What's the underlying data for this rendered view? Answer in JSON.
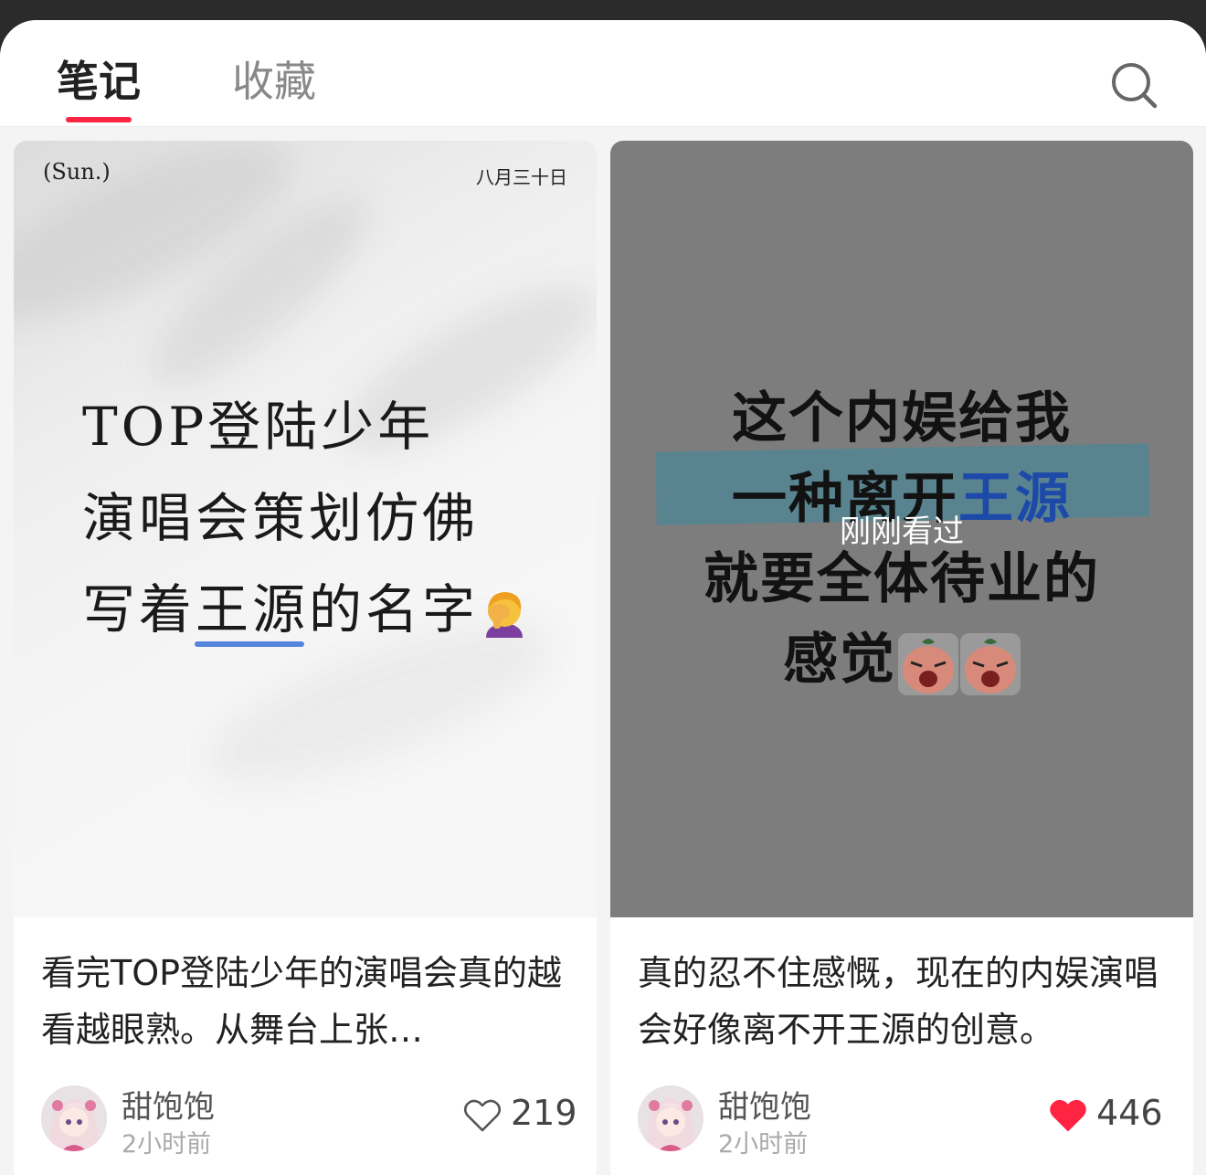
{
  "tabs": {
    "notes": "笔记",
    "favorites": "收藏"
  },
  "colors": {
    "accent": "#ff2442",
    "liked_heart": "#ff2442"
  },
  "icons": {
    "search": "search-icon",
    "like_outline": "heart-outline-icon",
    "like_filled": "heart-filled-icon"
  },
  "cards": [
    {
      "cover": {
        "weekday": "(Sun.)",
        "date": "八月三十日",
        "lines": [
          "TOP登陆少年",
          "演唱会策划仿佛",
          "写着王源的名字"
        ]
      },
      "title": "看完TOP登陆少年的演唱会真的越看越眼熟。从舞台上张…",
      "author": "甜饱饱",
      "time": "2小时前",
      "likes": "219",
      "liked": false
    },
    {
      "cover": {
        "lines": [
          "这个内娱给我",
          "一种离开",
          "王源",
          "就要全体待业的",
          "感觉"
        ],
        "overlay": "刚刚看过"
      },
      "title": "真的忍不住感慨，现在的内娱演唱会好像离不开王源的创意。",
      "author": "甜饱饱",
      "time": "2小时前",
      "likes": "446",
      "liked": true
    }
  ]
}
